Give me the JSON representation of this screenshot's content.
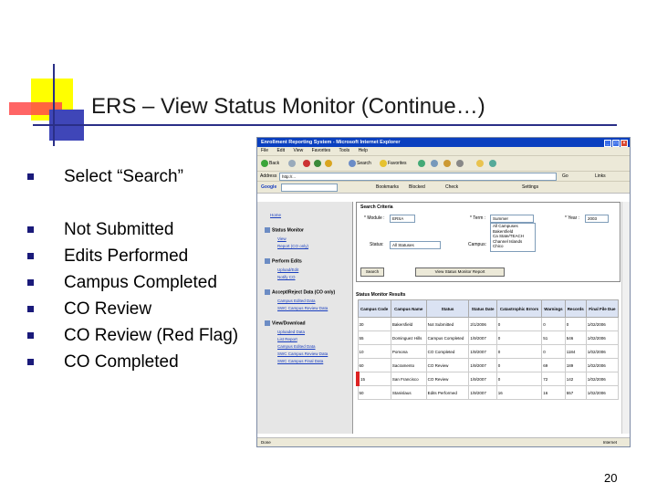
{
  "slide": {
    "title": "ERS – View Status Monitor (Continue…)",
    "page_number": "20",
    "bullets": [
      "Select “Search”",
      "Not Submitted",
      "Edits Performed",
      "Campus Completed",
      "CO Review",
      "CO Review (Red Flag)",
      "CO Completed"
    ]
  },
  "browser": {
    "title": "Enrollment Reporting System - Microsoft Internet Explorer",
    "menu": [
      "File",
      "Edit",
      "View",
      "Favorites",
      "Tools",
      "Help"
    ],
    "toolbar": {
      "back": "Back",
      "search": "Search",
      "favorites": "Favorites",
      "go": "Go",
      "links": "Links"
    },
    "address_label": "Address",
    "address": "http://...",
    "google_label": "Google",
    "gbar": {
      "bookmarks": "Bookmarks",
      "blocked": "Blocked",
      "check": "Check",
      "settings": "Settings"
    },
    "status_left": "Done",
    "status_right": "Internet",
    "sidebar": {
      "home": "Home",
      "status_monitor": "Status Monitor",
      "sm_links": [
        "View",
        "Report (CO only)"
      ],
      "perform_edits": "Perform Edits",
      "pe_links": [
        "Upload/Edit",
        "Notify CO"
      ],
      "accept": "Accept/Reject Data (CO only)",
      "ar_links": [
        "Campus Edited Data",
        "SWC Campus Review Data"
      ],
      "view_download": "View/Download",
      "vd_links": [
        "Uploaded Data",
        "List Report",
        "Campus Edited Data",
        "SWC Campus Review Data",
        "SWC Campus Final Data"
      ]
    },
    "criteria": {
      "title": "Search Criteria",
      "module_label": "* Module :",
      "module_value": "ERSA",
      "term_label": "* Term :",
      "term_value": "Summer",
      "year_label": "* Year :",
      "year_value": "2003",
      "status_label": "Status:",
      "status_value": "All Statuses",
      "campus_label": "Campus:",
      "campus_options": [
        "All Campuses",
        "Bakersfield",
        "Ca State/TEACH",
        "Channel Islands",
        "Chico"
      ],
      "search_button": "Search",
      "report_button": "View Status Monitor Report"
    },
    "results": {
      "title": "Status Monitor Results",
      "columns": [
        "Campus Code",
        "Campus Name",
        "Status",
        "Status Date",
        "Catastrophic Errors",
        "Warnings",
        "Records",
        "Final File Due"
      ],
      "rows": [
        {
          "code": "30",
          "name": "Bakersfield",
          "status": "Not Submitted",
          "date": "2/1/2006",
          "errors": "0",
          "warnings": "0",
          "records": "0",
          "due": "1/02/2006",
          "flag": false
        },
        {
          "code": "55",
          "name": "Dominguez Hills",
          "status": "Campus Completed",
          "date": "1/9/2007",
          "errors": "0",
          "warnings": "51",
          "records": "546",
          "due": "1/02/2006",
          "flag": false
        },
        {
          "code": "10",
          "name": "Pomona",
          "status": "CO Completed",
          "date": "1/9/2007",
          "errors": "0",
          "warnings": "0",
          "records": "1184",
          "due": "1/02/2006",
          "flag": false
        },
        {
          "code": "60",
          "name": "Sacramento",
          "status": "CO Review",
          "date": "1/9/2007",
          "errors": "0",
          "warnings": "69",
          "records": "189",
          "due": "1/02/2006",
          "flag": false
        },
        {
          "code": "15",
          "name": "San Francisco",
          "status": "CO Review",
          "date": "1/9/2007",
          "errors": "0",
          "warnings": "72",
          "records": "142",
          "due": "1/02/2006",
          "flag": true
        },
        {
          "code": "50",
          "name": "Stanislaus",
          "status": "Edits Performed",
          "date": "1/9/2007",
          "errors": "16",
          "warnings": "16",
          "records": "557",
          "due": "1/02/2006",
          "flag": false
        }
      ]
    }
  }
}
